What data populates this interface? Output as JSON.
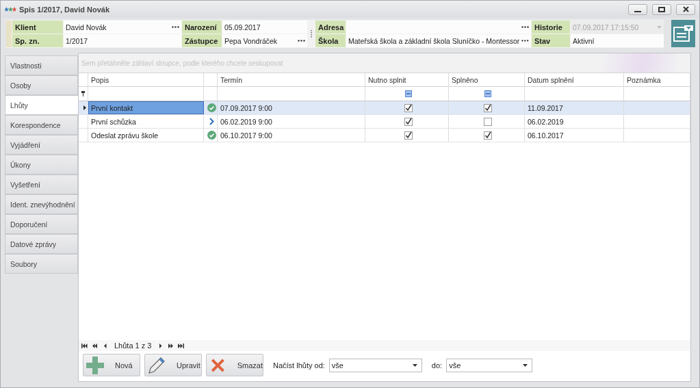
{
  "window": {
    "title": "Spis 1/2017, David Novák"
  },
  "header": {
    "fields": [
      {
        "label": "Klient",
        "value": "David Novák",
        "kind": "lookup",
        "disabled": false
      },
      {
        "label": "Narození",
        "value": "05.09.2017",
        "kind": "text",
        "disabled": false
      },
      {
        "label": "Adresa",
        "kind": "lookup",
        "disabled": false
      },
      {
        "label": "Historie",
        "value": "07.09.2017 17:15:50",
        "kind": "dropdown",
        "disabled": true
      },
      {
        "label": "Sp. zn.",
        "value": "1/2017",
        "kind": "text",
        "disabled": false
      },
      {
        "label": "Zástupce",
        "value": "Pepa Vondráček",
        "kind": "lookup",
        "disabled": false
      },
      {
        "label": "Škola",
        "value": "Mateřská škola a základní škola Sluníčko - Montessor",
        "kind": "lookup",
        "disabled": false
      },
      {
        "label": "Stav",
        "value": "Aktivní",
        "kind": "text",
        "disabled": false
      }
    ]
  },
  "tabs": [
    {
      "label": "Vlastnosti",
      "selected": false
    },
    {
      "label": "Osoby",
      "selected": false
    },
    {
      "label": "Lhůty",
      "selected": true
    },
    {
      "label": "Korespondence",
      "selected": false
    },
    {
      "label": "Vyjádření",
      "selected": false
    },
    {
      "label": "Úkony",
      "selected": false
    },
    {
      "label": "Vyšetření",
      "selected": false
    },
    {
      "label": "Ident. znevýhodnění",
      "selected": false
    },
    {
      "label": "Doporučení",
      "selected": false
    },
    {
      "label": "Datové zprávy",
      "selected": false
    },
    {
      "label": "Soubory",
      "selected": false
    }
  ],
  "grid": {
    "group_hint": "Sem přetáhněte záhlaví sloupce, podle kterého chcete seskupovat",
    "columns": [
      "Popis",
      "Termín",
      "Nutno splnit",
      "Splněno",
      "Datum splnění",
      "Poznámka"
    ],
    "rows": [
      {
        "popis": "První kontakt",
        "kind": "done",
        "termin": "07.09.2017 9:00",
        "nutno_splnit": true,
        "splneno": true,
        "datum_splneni": "11.09.2017",
        "selected": true
      },
      {
        "popis": "První schůzka",
        "kind": "pending",
        "termin": "06.02.2019 9:00",
        "nutno_splnit": true,
        "splneno": false,
        "datum_splneni": "06.02.2019",
        "selected": false
      },
      {
        "popis": "Odeslat zprávu škole",
        "kind": "done",
        "termin": "06.10.2017 9:00",
        "nutno_splnit": true,
        "splneno": true,
        "datum_splneni": "06.10.2017",
        "selected": false
      }
    ],
    "navigator": "Lhůta 1 z 3"
  },
  "buttons": [
    {
      "label": "Nová",
      "kind": "add"
    },
    {
      "label": "Upravit",
      "kind": "edit"
    },
    {
      "label": "Smazat",
      "kind": "delete"
    }
  ],
  "filter": {
    "from_label": "Načíst lhůty od:",
    "from_value": "vše",
    "to_label": "do:",
    "to_value": "vše"
  }
}
